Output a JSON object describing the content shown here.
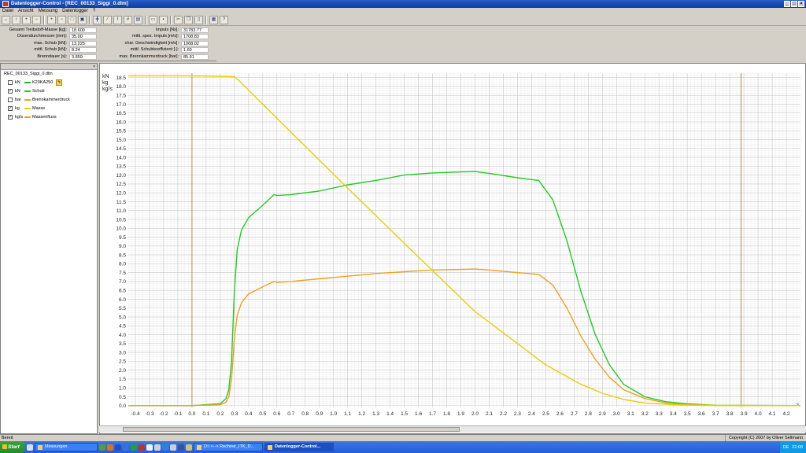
{
  "window": {
    "title": "Datenlogger-Control - [REC_00133_Siggi_0.dlm]"
  },
  "menu": [
    "Datei",
    "Ansicht",
    "Messung",
    "Datenlogger",
    "?"
  ],
  "toolbar": {
    "icons": [
      "zoom-x-icon",
      "zoom-y-icon",
      "zoom-in-x-icon",
      "zoom-out-x-icon",
      "zoom-in-y-icon",
      "zoom-out-y-icon",
      "fit-icon",
      "fit-all-icon",
      "cursor-icon",
      "chart-line-icon",
      "chart-cursor-icon",
      "chart-grid-icon",
      "chart-export-icon",
      "open-icon",
      "save-icon",
      "cut-icon",
      "copy-icon",
      "paste-icon",
      "print-icon",
      "help-icon"
    ]
  },
  "info": {
    "left": [
      {
        "label": "Gesamt Treibstoff-Masse [kg]:",
        "value": "18.600"
      },
      {
        "label": "Düsendurchmesser [mm]:",
        "value": "35.00"
      },
      {
        "label": "max. Schub [kN]:",
        "value": "13.225"
      },
      {
        "label": "mittl. Schub [kN]:",
        "value": "8.24"
      },
      {
        "label": "Brenndauer [s]:",
        "value": "3.859"
      }
    ],
    "right": [
      {
        "label": "Impuls [Ns]:",
        "value": "31783.77"
      },
      {
        "label": "mittl. spez. Impuls [m/s]:",
        "value": "1708.83"
      },
      {
        "label": "char. Geschwindigkeit [m/s]:",
        "value": "1068.02"
      },
      {
        "label": "mittl. Schubkoeffizient [-]:",
        "value": "1.60"
      },
      {
        "label": "max. Brennkammerdruck [bar]:",
        "value": "85.91"
      }
    ]
  },
  "panel": {
    "close": "×",
    "file": "REC_00133_Siggi_0.dlm",
    "channels": [
      {
        "checked": false,
        "unit": "kN",
        "name": "K20KA250",
        "color": "#22b422",
        "settings": true
      },
      {
        "checked": true,
        "unit": "kN",
        "name": "Schub",
        "color": "#22cc22"
      },
      {
        "checked": false,
        "unit": "bar",
        "name": "Brennkammerdruck",
        "color": "#f0a020"
      },
      {
        "checked": true,
        "unit": "kg",
        "name": "Masse",
        "color": "#e8d000"
      },
      {
        "checked": true,
        "unit": "kg/s",
        "name": "Massenfluss",
        "color": "#f0a020"
      }
    ]
  },
  "chart_data": {
    "type": "line",
    "xlim": [
      -0.45,
      4.3
    ],
    "ylim": [
      -0.1,
      18.75
    ],
    "ylabels": [
      "kN",
      "kg",
      "kg/s"
    ],
    "xunit": "s",
    "x_ticks": [
      "-0.4",
      "-0.3",
      "-0.2",
      "-0.1",
      "0.0",
      "0.1",
      "0.2",
      "0.3",
      "0.4",
      "0.5",
      "0.6",
      "0.7",
      "0.8",
      "0.9",
      "1.0",
      "1.1",
      "1.2",
      "1.3",
      "1.4",
      "1.5",
      "1.6",
      "1.7",
      "1.8",
      "1.9",
      "2.0",
      "2.1",
      "2.2",
      "2.3",
      "2.4",
      "2.5",
      "2.6",
      "2.7",
      "2.8",
      "2.9",
      "3.0",
      "3.1",
      "3.2",
      "3.3",
      "3.4",
      "3.5",
      "3.6",
      "3.7",
      "3.8",
      "3.9",
      "4.0",
      "4.1",
      "4.2"
    ],
    "y_ticks": [
      "0.0",
      "0.5",
      "1.0",
      "1.5",
      "2.0",
      "2.5",
      "3.0",
      "3.5",
      "4.0",
      "4.5",
      "5.0",
      "5.5",
      "6.0",
      "6.5",
      "7.0",
      "7.5",
      "8.0",
      "8.5",
      "9.0",
      "9.5",
      "10.0",
      "10.5",
      "11.0",
      "11.5",
      "12.0",
      "12.5",
      "13.0",
      "13.5",
      "14.0",
      "14.5",
      "15.0",
      "15.5",
      "16.0",
      "16.5",
      "17.0",
      "17.5",
      "18.0",
      "18.5"
    ],
    "markers_x": [
      0.0,
      3.88
    ],
    "series": [
      {
        "name": "Schub",
        "unit": "kN",
        "color": "#22cc22",
        "x": [
          -0.45,
          0.0,
          0.2,
          0.24,
          0.26,
          0.28,
          0.3,
          0.32,
          0.35,
          0.4,
          0.5,
          0.58,
          0.6,
          0.7,
          0.9,
          1.1,
          1.3,
          1.5,
          1.7,
          1.9,
          2.0,
          2.1,
          2.3,
          2.45,
          2.55,
          2.65,
          2.75,
          2.85,
          2.95,
          3.05,
          3.2,
          3.35,
          3.5,
          3.7,
          4.3
        ],
        "y": [
          0.0,
          0.0,
          0.1,
          0.4,
          0.9,
          2.5,
          6.5,
          8.8,
          9.9,
          10.6,
          11.3,
          11.9,
          11.85,
          11.9,
          12.1,
          12.45,
          12.7,
          13.0,
          13.12,
          13.18,
          13.2,
          13.1,
          12.85,
          12.7,
          11.6,
          9.3,
          6.4,
          4.0,
          2.3,
          1.2,
          0.5,
          0.22,
          0.1,
          0.02,
          0.0
        ]
      },
      {
        "name": "Massenfluss",
        "unit": "kg/s",
        "color": "#f0a020",
        "x": [
          -0.45,
          0.0,
          0.2,
          0.24,
          0.26,
          0.28,
          0.3,
          0.32,
          0.35,
          0.4,
          0.5,
          0.58,
          0.6,
          0.7,
          0.9,
          1.1,
          1.3,
          1.5,
          1.7,
          1.9,
          2.0,
          2.1,
          2.3,
          2.45,
          2.55,
          2.65,
          2.75,
          2.85,
          2.95,
          3.05,
          3.2,
          3.35,
          3.5,
          3.7,
          4.3
        ],
        "y": [
          0.0,
          0.0,
          0.05,
          0.2,
          0.5,
          1.5,
          3.8,
          5.1,
          5.8,
          6.3,
          6.7,
          7.0,
          6.95,
          7.0,
          7.15,
          7.3,
          7.45,
          7.55,
          7.65,
          7.68,
          7.7,
          7.65,
          7.5,
          7.4,
          6.8,
          5.5,
          3.9,
          2.6,
          1.6,
          0.9,
          0.4,
          0.15,
          0.06,
          0.01,
          0.0
        ]
      },
      {
        "name": "Masse",
        "unit": "kg",
        "color": "#e8d000",
        "x": [
          -0.45,
          0.0,
          0.3,
          0.33,
          0.5,
          1.0,
          1.5,
          2.0,
          2.5,
          2.75,
          2.9,
          3.05,
          3.2,
          3.4,
          3.6,
          3.8,
          4.3
        ],
        "y": [
          18.6,
          18.6,
          18.55,
          18.35,
          17.0,
          13.05,
          9.15,
          5.3,
          2.3,
          1.2,
          0.7,
          0.35,
          0.15,
          0.05,
          0.01,
          0.0,
          0.0
        ]
      }
    ]
  },
  "status": {
    "left": "Bereit",
    "copyright": "Copyright (C) 2007 by Oliver Sellmann"
  },
  "taskbar": {
    "start": "Start",
    "tasks": [
      {
        "label": "Messungen",
        "active": false
      },
      {
        "label": "D:\\ <--> Rechner_ITK_D...",
        "active": false
      },
      {
        "label": "Datenlogger-Control...",
        "active": true
      }
    ],
    "lang": "DE",
    "time": "22:00"
  }
}
